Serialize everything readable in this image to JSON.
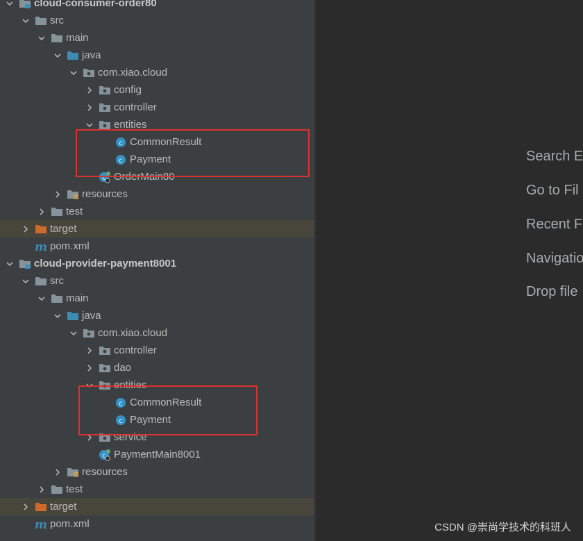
{
  "project_tree": {
    "modules": [
      {
        "name": "cloud-consumer-order80",
        "rows": [
          {
            "label": "cloud-consumer-order80",
            "kind": "module",
            "indent": 0,
            "expanded": true
          },
          {
            "label": "src",
            "kind": "folder",
            "indent": 1,
            "expanded": true
          },
          {
            "label": "main",
            "kind": "folder",
            "indent": 2,
            "expanded": true
          },
          {
            "label": "java",
            "kind": "source-folder",
            "indent": 3,
            "expanded": true
          },
          {
            "label": "com.xiao.cloud",
            "kind": "package",
            "indent": 4,
            "expanded": true
          },
          {
            "label": "config",
            "kind": "package",
            "indent": 5,
            "expanded": false
          },
          {
            "label": "controller",
            "kind": "package",
            "indent": 5,
            "expanded": false
          },
          {
            "label": "entities",
            "kind": "package",
            "indent": 5,
            "expanded": true
          },
          {
            "label": "CommonResult",
            "kind": "class",
            "indent": 6
          },
          {
            "label": "Payment",
            "kind": "class",
            "indent": 6
          },
          {
            "label": "OrderMain80",
            "kind": "spring-class",
            "indent": 5
          },
          {
            "label": "resources",
            "kind": "resources-folder",
            "indent": 3,
            "expanded": false
          },
          {
            "label": "test",
            "kind": "folder",
            "indent": 2,
            "expanded": false
          },
          {
            "label": "target",
            "kind": "excluded-folder",
            "indent": 1,
            "expanded": false,
            "highlighted": true
          },
          {
            "label": "pom.xml",
            "kind": "maven-file",
            "indent": 1
          }
        ]
      },
      {
        "name": "cloud-provider-payment8001",
        "rows": [
          {
            "label": "cloud-provider-payment8001",
            "kind": "module",
            "indent": 0,
            "expanded": true
          },
          {
            "label": "src",
            "kind": "folder",
            "indent": 1,
            "expanded": true
          },
          {
            "label": "main",
            "kind": "folder",
            "indent": 2,
            "expanded": true
          },
          {
            "label": "java",
            "kind": "source-folder",
            "indent": 3,
            "expanded": true
          },
          {
            "label": "com.xiao.cloud",
            "kind": "package",
            "indent": 4,
            "expanded": true
          },
          {
            "label": "controller",
            "kind": "package",
            "indent": 5,
            "expanded": false
          },
          {
            "label": "dao",
            "kind": "package",
            "indent": 5,
            "expanded": false
          },
          {
            "label": "entities",
            "kind": "package",
            "indent": 5,
            "expanded": true
          },
          {
            "label": "CommonResult",
            "kind": "class",
            "indent": 6
          },
          {
            "label": "Payment",
            "kind": "class",
            "indent": 6
          },
          {
            "label": "service",
            "kind": "package",
            "indent": 5,
            "expanded": false
          },
          {
            "label": "PaymentMain8001",
            "kind": "spring-class",
            "indent": 5
          },
          {
            "label": "resources",
            "kind": "resources-folder",
            "indent": 3,
            "expanded": false
          },
          {
            "label": "test",
            "kind": "folder",
            "indent": 2,
            "expanded": false
          },
          {
            "label": "target",
            "kind": "excluded-folder",
            "indent": 1,
            "expanded": false,
            "highlighted": true
          },
          {
            "label": "pom.xml",
            "kind": "maven-file",
            "indent": 1
          }
        ]
      }
    ]
  },
  "editor_placeholder": {
    "actions": [
      "Search E",
      "Go to Fil",
      "Recent F",
      "Navigatio",
      "Drop file"
    ]
  },
  "watermark": "CSDN @崇尚学技术的科班人",
  "colors": {
    "panel_bg": "#3c3f41",
    "editor_bg": "#2b2b2b",
    "highlight_row": "#48463b",
    "annotation_box": "#d9322f",
    "folder_icon": "#87939a",
    "source_folder_icon": "#3d8bb3",
    "excluded_folder_icon": "#cf6a2c",
    "class_icon": "#3592c4",
    "maven_icon": "#3d8bb3"
  }
}
